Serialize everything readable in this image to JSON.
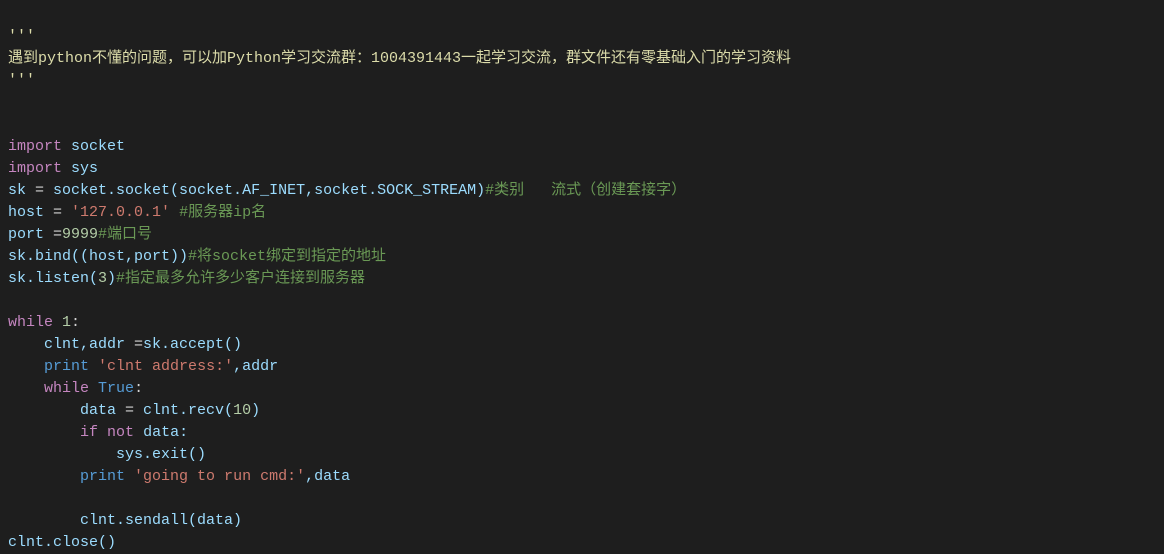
{
  "code": {
    "docstring_open": "'''",
    "docstring_text": "遇到python不懂的问题，可以加Python学习交流群：1004391443一起学习交流，群文件还有零基础入门的学习资料",
    "docstring_close": "'''",
    "l5_import": "import",
    "l5_mod": " socket",
    "l6_import": "import",
    "l6_mod": " sys",
    "l7_sk": "sk ",
    "l7_eq": "=",
    "l7_rest": " socket.socket(socket.AF_INET,socket.SOCK_STREAM)",
    "l7_comment": "#类别   流式（创建套接字）",
    "l8_host": "host ",
    "l8_eq": "=",
    "l8_sp": " ",
    "l8_str": "'127.0.0.1'",
    "l8_sp2": " ",
    "l8_comment": "#服务器ip名",
    "l9_port": "port ",
    "l9_eq": "=",
    "l9_num": "9999",
    "l9_comment": "#端口号",
    "l10_call": "sk.bind((host,port))",
    "l10_comment": "#将socket绑定到指定的地址",
    "l11_pre": "sk.listen(",
    "l11_num": "3",
    "l11_post": ")",
    "l11_comment": "#指定最多允许多少客户连接到服务器",
    "l13_while": "while",
    "l13_sp": " ",
    "l13_num": "1",
    "l13_colon": ":",
    "l14_indent": "    ",
    "l14_lhs": "clnt,addr ",
    "l14_eq": "=",
    "l14_rhs": "sk.accept()",
    "l15_indent": "    ",
    "l15_print": "print",
    "l15_sp": " ",
    "l15_str": "'clnt address:'",
    "l15_rest": ",addr",
    "l16_indent": "    ",
    "l16_while": "while",
    "l16_sp": " ",
    "l16_true": "True",
    "l16_colon": ":",
    "l17_indent": "        ",
    "l17_lhs": "data ",
    "l17_eq": "=",
    "l17_mid": " clnt.recv(",
    "l17_num": "10",
    "l17_close": ")",
    "l18_indent": "        ",
    "l18_if": "if",
    "l18_sp": " ",
    "l18_not": "not",
    "l18_rest": " data:",
    "l19_indent": "            ",
    "l19_call": "sys.exit()",
    "l20_indent": "        ",
    "l20_print": "print",
    "l20_sp": " ",
    "l20_str": "'going to run cmd:'",
    "l20_rest": ",data",
    "l22_indent": "        ",
    "l22_call": "clnt.sendall(data)",
    "l23_call": "clnt.close()"
  }
}
